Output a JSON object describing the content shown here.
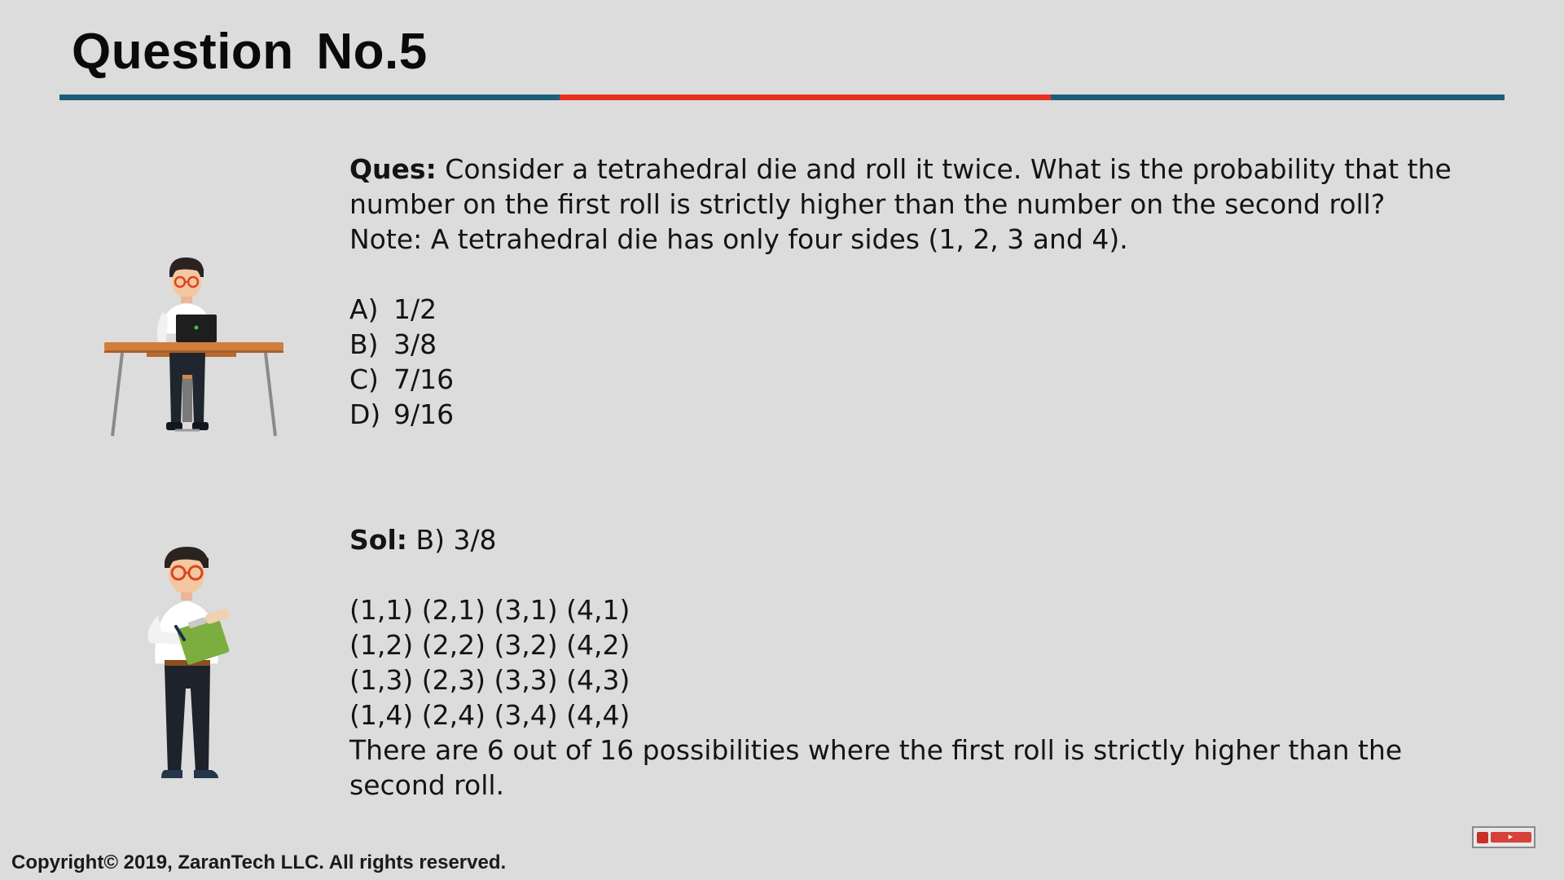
{
  "slide": {
    "title": "Question No.5",
    "question": {
      "label": "Ques:",
      "text": " Consider a tetrahedral die and roll it twice. What is the probability that the number on the first roll is strictly higher than the number on the second roll?",
      "note": "Note: A tetrahedral die has only four sides (1, 2, 3 and 4)."
    },
    "options": [
      {
        "letter": "A)",
        "value": "1/2"
      },
      {
        "letter": "B)",
        "value": "3/8"
      },
      {
        "letter": "C)",
        "value": "7/16"
      },
      {
        "letter": "D)",
        "value": "9/16"
      }
    ],
    "solution": {
      "label": "Sol:",
      "answer": " B) 3/8",
      "rows": [
        "(1,1) (2,1) (3,1) (4,1)",
        "(1,2) (2,2) (3,2) (4,2)",
        "(1,3) (2,3) (3,3) (4,3)",
        "(1,4) (2,4) (3,4) (4,4)"
      ],
      "explanation": "There are 6 out of 16 possibilities where the first roll is strictly higher than the second roll."
    },
    "footer": "Copyright© 2019, ZaranTech LLC. All rights reserved."
  },
  "colors": {
    "background": "#dcdcdc",
    "rule": "#1d5d7a",
    "rule_accent": "#e8311e"
  }
}
